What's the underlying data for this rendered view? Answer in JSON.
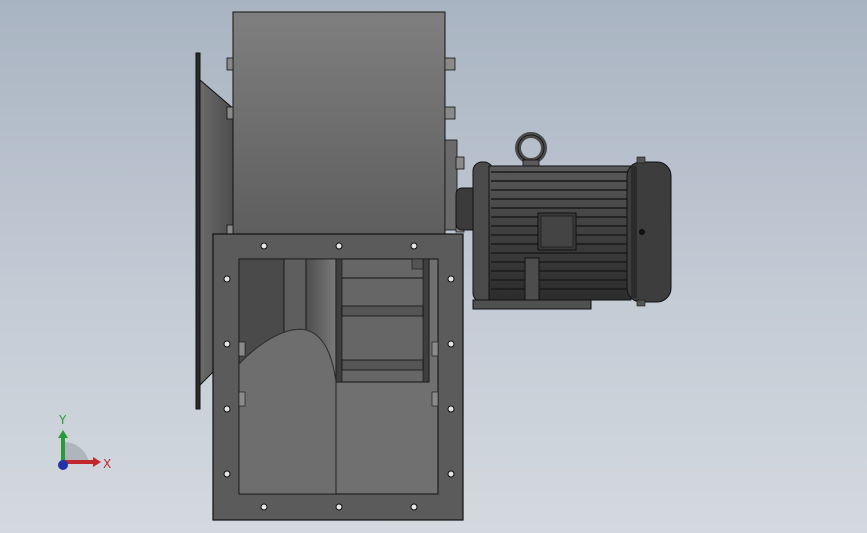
{
  "viewport": {
    "background_top": "#a9b4c2",
    "background_bottom": "#d4d9df"
  },
  "model": {
    "body_color": "#6f6f6f",
    "dark_color": "#4a4a4a",
    "edge_color": "#111111"
  },
  "triad": {
    "x_label": "X",
    "y_label": "Y",
    "x_color": "#c0282b",
    "y_color": "#2a9a3a",
    "z_color": "#2233aa"
  }
}
